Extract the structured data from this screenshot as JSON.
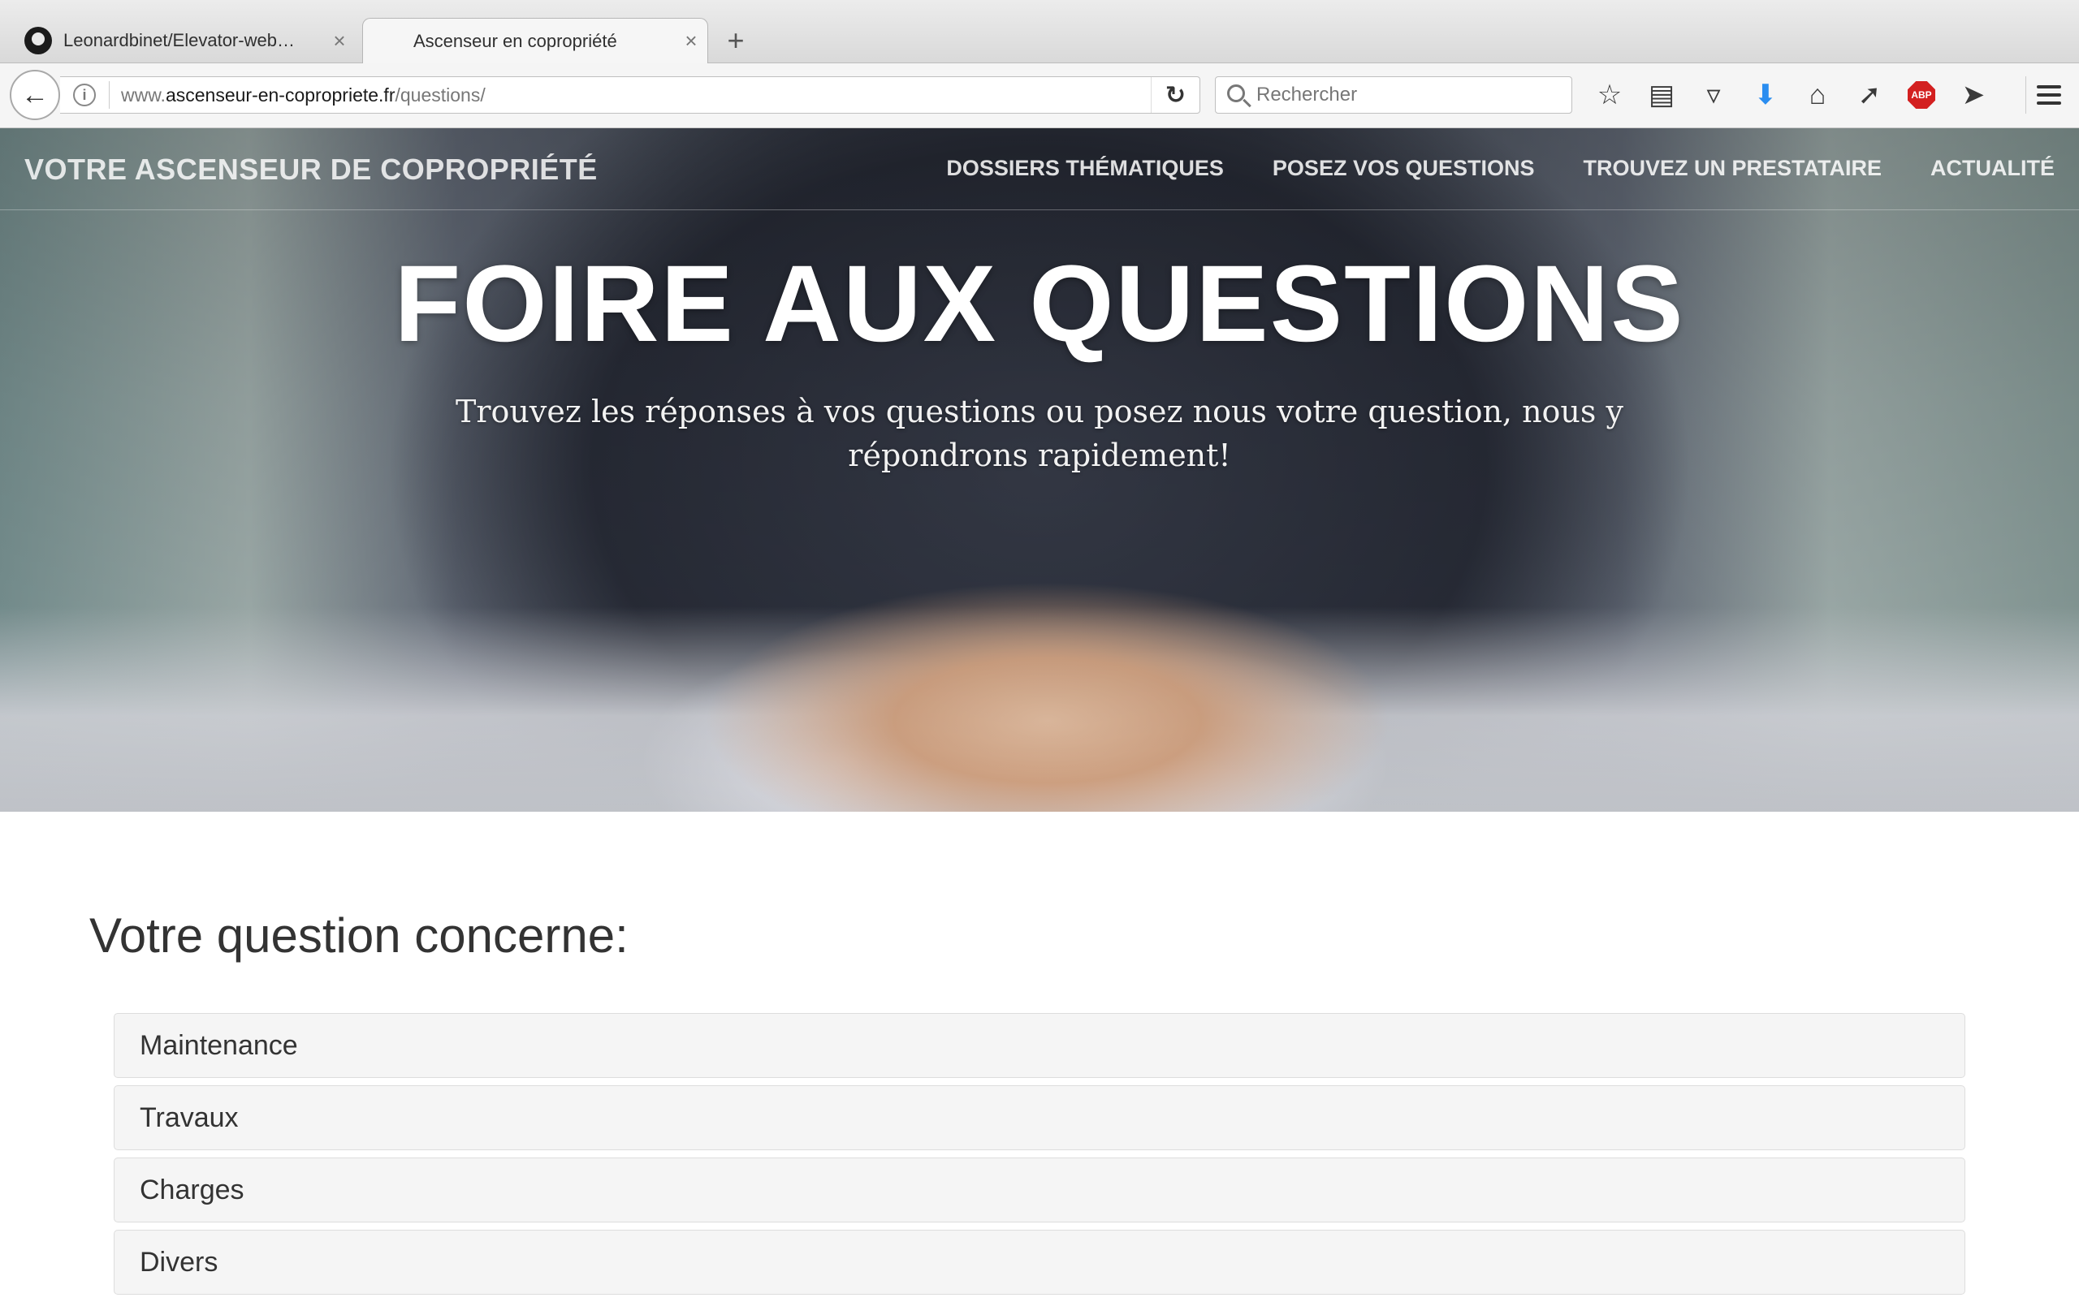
{
  "browser": {
    "tabs": [
      {
        "title": "Leonardbinet/Elevator-web…",
        "close": "×",
        "active": false
      },
      {
        "title": "Ascenseur en copropriété",
        "close": "×",
        "active": true
      }
    ],
    "new_tab": "+",
    "url_prefix": "www.",
    "url_host": "ascenseur-en-copropriete.fr",
    "url_path": "/questions/",
    "search_placeholder": "Rechercher"
  },
  "site": {
    "title": "VOTRE ASCENSEUR DE COPROPRIÉTÉ",
    "nav": [
      "DOSSIERS THÉMATIQUES",
      "POSEZ VOS QUESTIONS",
      "TROUVEZ UN PRESTATAIRE",
      "ACTUALITÉ"
    ]
  },
  "hero": {
    "title": "FOIRE AUX QUESTIONS",
    "subtitle": "Trouvez les réponses à vos questions ou posez nous votre question, nous y répondrons rapidement!"
  },
  "faq": {
    "heading": "Votre question concerne:",
    "categories": [
      "Maintenance",
      "Travaux",
      "Charges",
      "Divers"
    ]
  },
  "colors": {
    "accent_download": "#2a8df0",
    "adblock": "#d32020",
    "panel_bg": "#f5f5f5",
    "text_dark": "#333333"
  }
}
